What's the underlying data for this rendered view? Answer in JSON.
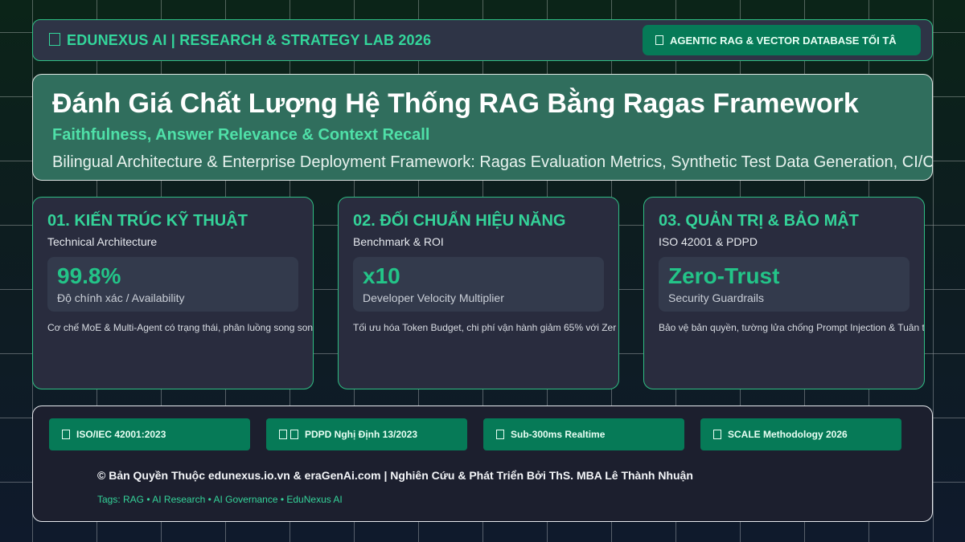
{
  "header": {
    "brand": "EDUNEXUS AI | RESEARCH & STRATEGY LAB 2026",
    "brand_icon": "box-icon",
    "tag": "AGENTIC RAG & VECTOR DATABASE TỐI TÂ",
    "tag_icon": "box-icon"
  },
  "hero": {
    "title": "Đánh Giá Chất Lượng Hệ Thống RAG Bằng Ragas Framework",
    "subtitle": "Faithfulness, Answer Relevance & Context Recall",
    "description": "Bilingual Architecture & Enterprise Deployment Framework: Ragas Evaluation Metrics, Synthetic Test Data Generation, CI/CD A"
  },
  "cards": [
    {
      "title": "01. KIẾN TRÚC KỸ THUẬT",
      "subtitle": "Technical Architecture",
      "metric_value": "99.8%",
      "metric_label": "Độ chính xác / Availability",
      "note": "Cơ chế MoE & Multi-Agent có trạng thái, phân luồng song son"
    },
    {
      "title": "02. ĐỐI CHUẨN HIỆU NĂNG",
      "subtitle": "Benchmark & ROI",
      "metric_value": "x10",
      "metric_label": "Developer Velocity Multiplier",
      "note": "Tối ưu hóa Token Budget, chi phí vận hành giảm 65% với Zer"
    },
    {
      "title": "03. QUẢN TRỊ & BẢO MẬT",
      "subtitle": "ISO 42001 & PDPD",
      "metric_value": "Zero-Trust",
      "metric_label": "Security Guardrails",
      "note": "Bảo vệ bản quyền, tường lửa chống Prompt Injection & Tuân thủ"
    }
  ],
  "footer": {
    "badges": [
      {
        "label": "ISO/IEC 42001:2023",
        "icon": "box-icon"
      },
      {
        "label": "PDPD Nghị Định 13/2023",
        "icon": "box-icon"
      },
      {
        "label": "Sub-300ms Realtime",
        "icon": "box-icon"
      },
      {
        "label": "SCALE Methodology 2026",
        "icon": "box-icon"
      }
    ],
    "copyright": "© Bản Quyền Thuộc edunexus.io.vn & eraGenAi.com | Nghiên Cứu & Phát Triển Bởi ThS. MBA Lê Thành Nhuận",
    "tags": "Tags: RAG • AI Research • AI Governance • EduNexus AI"
  },
  "colors": {
    "accent": "#34d399",
    "pill": "#067a57",
    "hero_bg": "#306e5d",
    "card_bg": "#292c3e"
  }
}
